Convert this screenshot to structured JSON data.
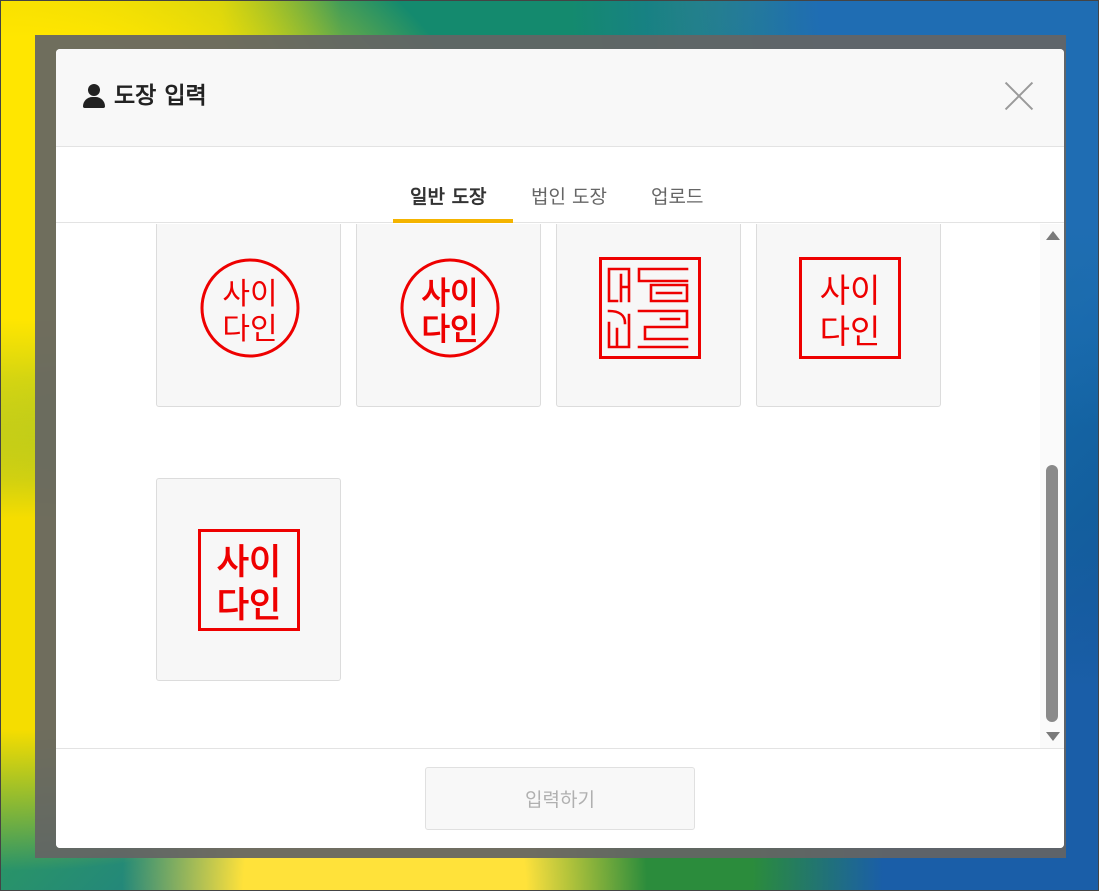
{
  "modal": {
    "title": "도장 입력",
    "title_icon": "person-icon",
    "close_icon": "close-icon"
  },
  "tabs": [
    {
      "label": "일반 도장",
      "active": true
    },
    {
      "label": "법인 도장",
      "active": false
    },
    {
      "label": "업로드",
      "active": false
    }
  ],
  "stamps": [
    {
      "style": "circle-regular",
      "line1": "사이",
      "line2": "다인"
    },
    {
      "style": "circle-bold",
      "line1": "사이",
      "line2": "다인"
    },
    {
      "style": "square-seal-script",
      "line1": "",
      "line2": ""
    },
    {
      "style": "square-regular",
      "line1": "사이",
      "line2": "다인"
    },
    {
      "style": "square-bold",
      "line1": "사이",
      "line2": "다인"
    }
  ],
  "footer": {
    "submit_label": "입력하기"
  },
  "colors": {
    "stamp_red": "#ee0000",
    "tab_accent": "#f4b400"
  }
}
